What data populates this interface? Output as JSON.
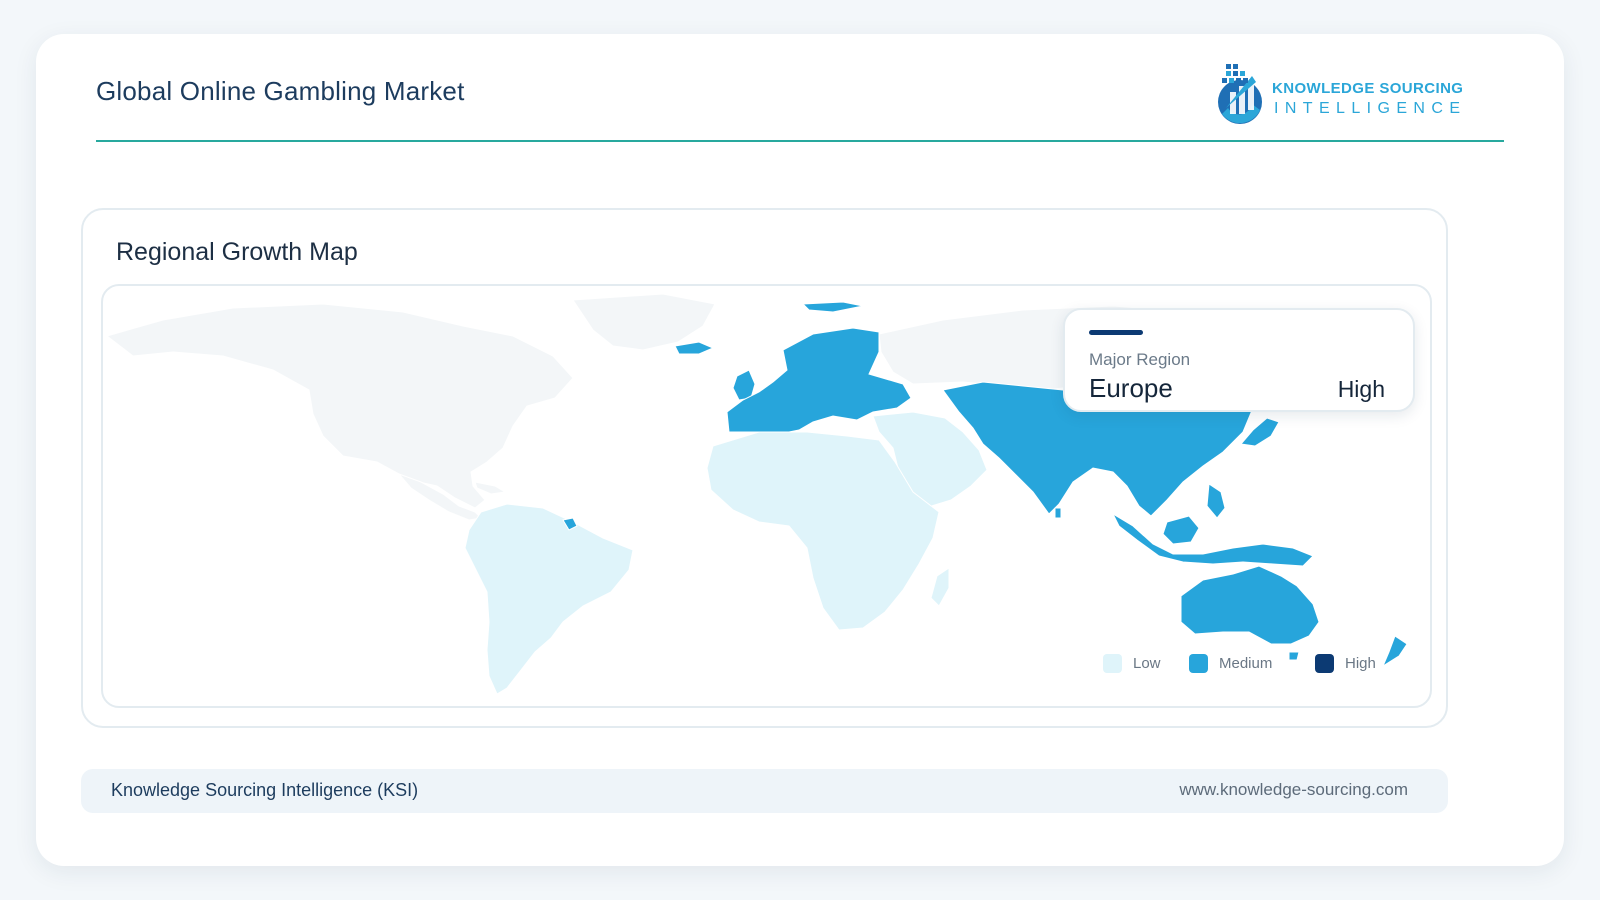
{
  "header": {
    "title": "Global Online Gambling Market",
    "logo_line1": "KNOWLEDGE SOURCING",
    "logo_line2": "INTELLIGENCE"
  },
  "panel": {
    "title": "Regional Growth Map"
  },
  "tooltip": {
    "label": "Major Region",
    "region": "Europe",
    "level": "High"
  },
  "legend": [
    {
      "label": "Low",
      "color": "#dff4fa"
    },
    {
      "label": "Medium",
      "color": "#27a5db"
    },
    {
      "label": "High",
      "color": "#0c3a73"
    }
  ],
  "map": {
    "regions": [
      {
        "name": "North America",
        "level": "None"
      },
      {
        "name": "South America",
        "level": "Low"
      },
      {
        "name": "Africa",
        "level": "Low"
      },
      {
        "name": "Middle East",
        "level": "Low"
      },
      {
        "name": "Europe",
        "level": "Medium"
      },
      {
        "name": "Asia Pacific",
        "level": "Medium"
      }
    ],
    "colors": {
      "none": "#f3f6f8",
      "low": "#dff4fa",
      "medium": "#27a5db",
      "high": "#0c3a73"
    }
  },
  "footer": {
    "left": "Knowledge Sourcing Intelligence (KSI)",
    "right": "www.knowledge-sourcing.com"
  }
}
